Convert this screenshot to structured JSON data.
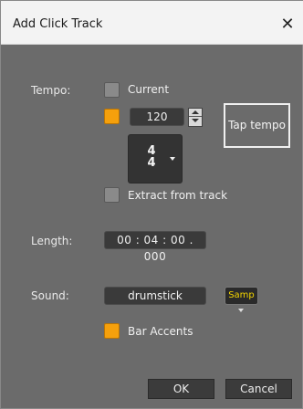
{
  "window": {
    "title": "Add Click Track",
    "close_glyph": "✕"
  },
  "tempo": {
    "label": "Tempo:",
    "current_label": "Current",
    "current_checked": false,
    "custom_checked": true,
    "bpm": "120",
    "time_sig_top": "4",
    "time_sig_bottom": "4",
    "tap_label": "Tap tempo",
    "extract_label": "Extract from track",
    "extract_checked": false
  },
  "length": {
    "label": "Length:",
    "value": "00 : 04 : 00 . 000"
  },
  "sound": {
    "label": "Sound:",
    "value": "drumstick",
    "samp_label": "Samp",
    "bar_accents_label": "Bar Accents",
    "bar_accents_checked": true
  },
  "buttons": {
    "ok": "OK",
    "cancel": "Cancel"
  },
  "colors": {
    "accent": "#f5a00c",
    "samp_text": "#f3d400",
    "panel": "#6b6b6b"
  }
}
